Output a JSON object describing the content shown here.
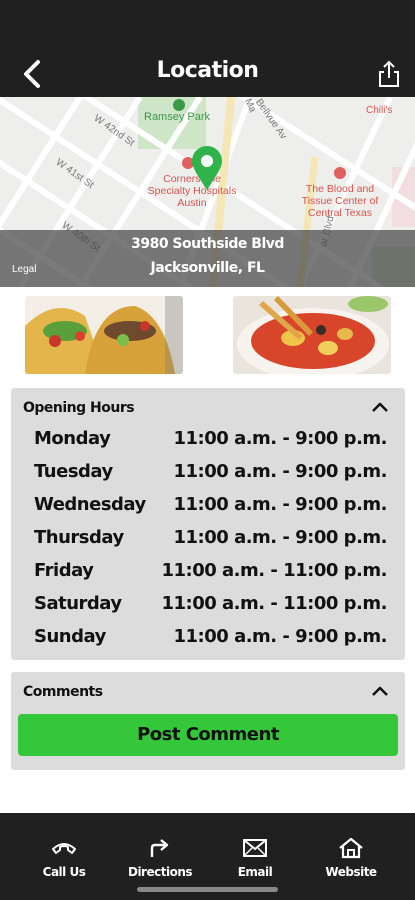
{
  "header": {
    "title": "Location",
    "back_icon": "chevron-left-icon",
    "share_icon": "share-icon"
  },
  "map": {
    "streets": [
      "W 42nd St",
      "W 41st St",
      "W 40th St",
      "Bellvue Av",
      "Ma",
      "ar Blvd"
    ],
    "poi_park": "Ramsey Park",
    "poi_hospital": "Cornerstone Specialty Hospitals Austin",
    "poi_blood": "The Blood and Tissue Center of Central Texas",
    "poi_chilis": "Chili's",
    "legal": "Legal",
    "address_line1": "3980 Southside Blvd",
    "address_line2": "Jacksonville, FL"
  },
  "photos": [
    {
      "name": "tacos-photo"
    },
    {
      "name": "soup-photo"
    }
  ],
  "hours": {
    "title": "Opening Hours",
    "rows": [
      {
        "day": "Monday",
        "time": "11:00 a.m. - 9:00 p.m."
      },
      {
        "day": "Tuesday",
        "time": "11:00 a.m. - 9:00 p.m."
      },
      {
        "day": "Wednesday",
        "time": "11:00 a.m. - 9:00 p.m."
      },
      {
        "day": "Thursday",
        "time": "11:00 a.m. - 9:00 p.m."
      },
      {
        "day": "Friday",
        "time": "11:00 a.m. - 11:00 p.m."
      },
      {
        "day": "Saturday",
        "time": "11:00 a.m. - 11:00 p.m."
      },
      {
        "day": "Sunday",
        "time": "11:00 a.m. - 9:00 p.m."
      }
    ]
  },
  "comments": {
    "title": "Comments",
    "post_label": "Post Comment"
  },
  "tabbar": {
    "call": "Call Us",
    "directions": "Directions",
    "email": "Email",
    "website": "Website"
  },
  "colors": {
    "header_bg": "#202020",
    "accent_green": "#34c73a",
    "card_bg": "#dcdcdc",
    "pin_green": "#2fb34a"
  }
}
